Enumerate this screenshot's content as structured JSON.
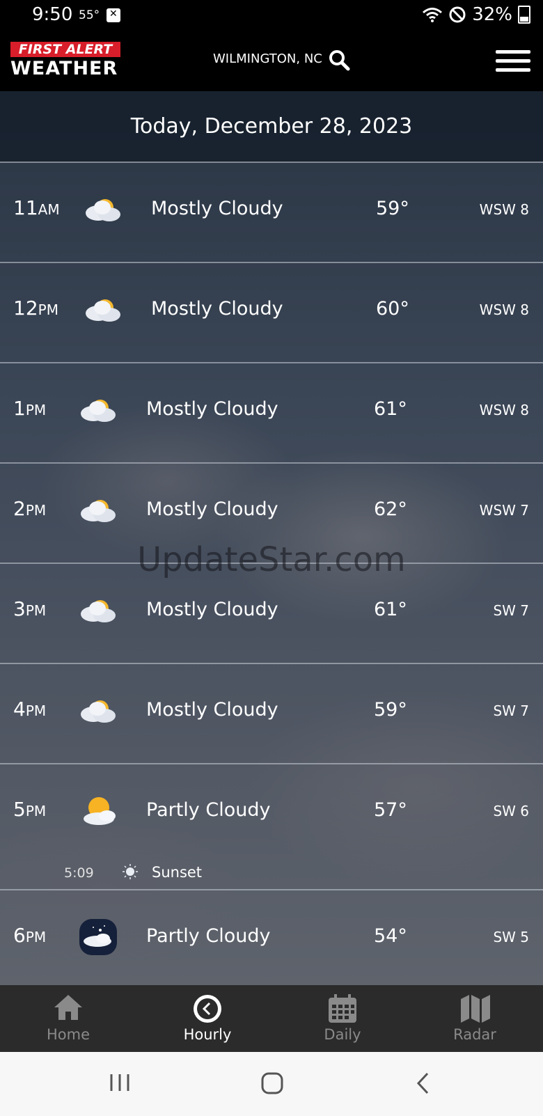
{
  "status_bar": {
    "time": "9:50",
    "temp": "55°",
    "battery": "32%"
  },
  "header": {
    "logo_top": "FIRST ALERT",
    "logo_bottom": "WEATHER",
    "location": "WILMINGTON, NC"
  },
  "date_banner": "Today, December 28, 2023",
  "hours": [
    {
      "hour": "11",
      "ampm": "AM",
      "condition": "Mostly Cloudy",
      "temp": "59°",
      "wind": "WSW 8",
      "icon": "mostly-cloudy-icon"
    },
    {
      "hour": "12",
      "ampm": "PM",
      "condition": "Mostly Cloudy",
      "temp": "60°",
      "wind": "WSW 8",
      "icon": "mostly-cloudy-icon"
    },
    {
      "hour": "1",
      "ampm": "PM",
      "condition": "Mostly Cloudy",
      "temp": "61°",
      "wind": "WSW 8",
      "icon": "mostly-cloudy-icon"
    },
    {
      "hour": "2",
      "ampm": "PM",
      "condition": "Mostly Cloudy",
      "temp": "62°",
      "wind": "WSW 7",
      "icon": "mostly-cloudy-icon"
    },
    {
      "hour": "3",
      "ampm": "PM",
      "condition": "Mostly Cloudy",
      "temp": "61°",
      "wind": "SW 7",
      "icon": "mostly-cloudy-icon"
    },
    {
      "hour": "4",
      "ampm": "PM",
      "condition": "Mostly Cloudy",
      "temp": "59°",
      "wind": "SW 7",
      "icon": "mostly-cloudy-icon"
    },
    {
      "hour": "5",
      "ampm": "PM",
      "condition": "Partly Cloudy",
      "temp": "57°",
      "wind": "SW 6",
      "icon": "partly-cloudy-icon"
    },
    {
      "hour": "6",
      "ampm": "PM",
      "condition": "Partly Cloudy",
      "temp": "54°",
      "wind": "SW 5",
      "icon": "partly-cloudy-night-icon"
    }
  ],
  "sunset": {
    "time": "5:09",
    "label": "Sunset"
  },
  "watermark": "UpdateStar.com",
  "nav": {
    "home": "Home",
    "hourly": "Hourly",
    "daily": "Daily",
    "radar": "Radar"
  }
}
